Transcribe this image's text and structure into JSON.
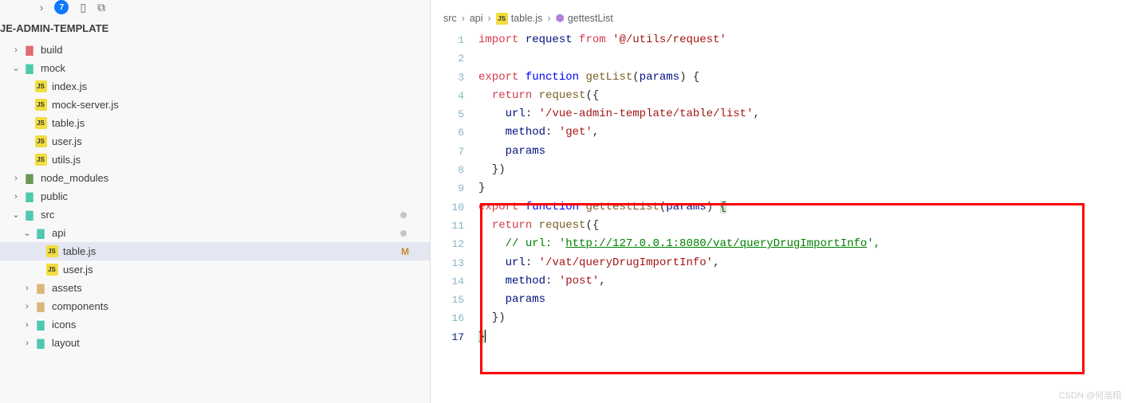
{
  "sidebar": {
    "badge": "7",
    "project": "JE-ADMIN-TEMPLATE",
    "items": [
      {
        "type": "folder",
        "label": "build",
        "indent": 0,
        "chev": "right",
        "iconc": "folder-red"
      },
      {
        "type": "folder",
        "label": "mock",
        "indent": 0,
        "chev": "down",
        "iconc": "folder-teal"
      },
      {
        "type": "js",
        "label": "index.js",
        "indent": 1
      },
      {
        "type": "js",
        "label": "mock-server.js",
        "indent": 1
      },
      {
        "type": "js",
        "label": "table.js",
        "indent": 1
      },
      {
        "type": "js",
        "label": "user.js",
        "indent": 1
      },
      {
        "type": "js",
        "label": "utils.js",
        "indent": 1
      },
      {
        "type": "folder",
        "label": "node_modules",
        "indent": 0,
        "chev": "right",
        "iconc": "folder-green"
      },
      {
        "type": "folder",
        "label": "public",
        "indent": 0,
        "chev": "right",
        "iconc": "folder-teal"
      },
      {
        "type": "folder",
        "label": "src",
        "indent": 0,
        "chev": "down",
        "iconc": "folder-teal",
        "dot": true
      },
      {
        "type": "folder",
        "label": "api",
        "indent": 1,
        "chev": "down",
        "iconc": "folder-teal",
        "dot": true
      },
      {
        "type": "js",
        "label": "table.js",
        "indent": 2,
        "selected": true,
        "status": "M"
      },
      {
        "type": "js",
        "label": "user.js",
        "indent": 2
      },
      {
        "type": "folder",
        "label": "assets",
        "indent": 1,
        "chev": "right",
        "iconc": "folder-icon"
      },
      {
        "type": "folder",
        "label": "components",
        "indent": 1,
        "chev": "right",
        "iconc": "folder-icon"
      },
      {
        "type": "folder",
        "label": "icons",
        "indent": 1,
        "chev": "right",
        "iconc": "folder-teal"
      },
      {
        "type": "folder",
        "label": "layout",
        "indent": 1,
        "chev": "right",
        "iconc": "folder-teal"
      }
    ]
  },
  "breadcrumb": {
    "parts": [
      "src",
      "api"
    ],
    "file": "table.js",
    "symbol": "gettestList"
  },
  "code": {
    "lines": [
      {
        "n": 1,
        "seg": [
          [
            "kw",
            "import"
          ],
          [
            "plain",
            " "
          ],
          [
            "ident",
            "request"
          ],
          [
            "plain",
            " "
          ],
          [
            "kw",
            "from"
          ],
          [
            "plain",
            " "
          ],
          [
            "str",
            "'@/utils/request'"
          ]
        ]
      },
      {
        "n": 2,
        "seg": []
      },
      {
        "n": 3,
        "seg": [
          [
            "kw",
            "export"
          ],
          [
            "plain",
            " "
          ],
          [
            "kw2",
            "function"
          ],
          [
            "plain",
            " "
          ],
          [
            "fn",
            "getList"
          ],
          [
            "plain",
            "("
          ],
          [
            "param",
            "params"
          ],
          [
            "plain",
            ") {"
          ]
        ]
      },
      {
        "n": 4,
        "seg": [
          [
            "plain",
            "  "
          ],
          [
            "kw",
            "return"
          ],
          [
            "plain",
            " "
          ],
          [
            "fn",
            "request"
          ],
          [
            "plain",
            "({"
          ]
        ]
      },
      {
        "n": 5,
        "seg": [
          [
            "plain",
            "    "
          ],
          [
            "ident",
            "url"
          ],
          [
            "plain",
            ": "
          ],
          [
            "str",
            "'/vue-admin-template/table/list'"
          ],
          [
            "plain",
            ","
          ]
        ]
      },
      {
        "n": 6,
        "seg": [
          [
            "plain",
            "    "
          ],
          [
            "ident",
            "method"
          ],
          [
            "plain",
            ": "
          ],
          [
            "str",
            "'get'"
          ],
          [
            "plain",
            ","
          ]
        ]
      },
      {
        "n": 7,
        "seg": [
          [
            "plain",
            "    "
          ],
          [
            "ident",
            "params"
          ]
        ]
      },
      {
        "n": 8,
        "seg": [
          [
            "plain",
            "  })"
          ]
        ]
      },
      {
        "n": 9,
        "seg": [
          [
            "plain",
            "}"
          ]
        ]
      },
      {
        "n": 10,
        "seg": [
          [
            "kw",
            "export"
          ],
          [
            "plain",
            " "
          ],
          [
            "kw2",
            "function"
          ],
          [
            "plain",
            " "
          ],
          [
            "fn",
            "gettestList"
          ],
          [
            "plain",
            "("
          ],
          [
            "param",
            "params"
          ],
          [
            "plain",
            ") "
          ],
          [
            "hl",
            "{"
          ]
        ]
      },
      {
        "n": 11,
        "seg": [
          [
            "plain",
            "  "
          ],
          [
            "kw",
            "return"
          ],
          [
            "plain",
            " "
          ],
          [
            "fn",
            "request"
          ],
          [
            "plain",
            "({"
          ]
        ]
      },
      {
        "n": 12,
        "seg": [
          [
            "plain",
            "    "
          ],
          [
            "comment",
            "// url: '"
          ],
          [
            "comment-u",
            "http://127.0.0.1:8080/vat/queryDrugImportInfo"
          ],
          [
            "comment",
            "',"
          ]
        ]
      },
      {
        "n": 13,
        "seg": [
          [
            "plain",
            "    "
          ],
          [
            "ident",
            "url"
          ],
          [
            "plain",
            ": "
          ],
          [
            "str",
            "'/vat/queryDrugImportInfo'"
          ],
          [
            "plain",
            ","
          ]
        ]
      },
      {
        "n": 14,
        "seg": [
          [
            "plain",
            "    "
          ],
          [
            "ident",
            "method"
          ],
          [
            "plain",
            ": "
          ],
          [
            "str",
            "'post'"
          ],
          [
            "plain",
            ","
          ]
        ]
      },
      {
        "n": 15,
        "seg": [
          [
            "plain",
            "    "
          ],
          [
            "ident",
            "params"
          ]
        ]
      },
      {
        "n": 16,
        "seg": [
          [
            "plain",
            "  })"
          ]
        ]
      },
      {
        "n": 17,
        "seg": [
          [
            "hl",
            "}"
          ],
          [
            "cursor",
            ""
          ]
        ],
        "active": true
      }
    ]
  },
  "watermark": "CSDN @何浩翔"
}
